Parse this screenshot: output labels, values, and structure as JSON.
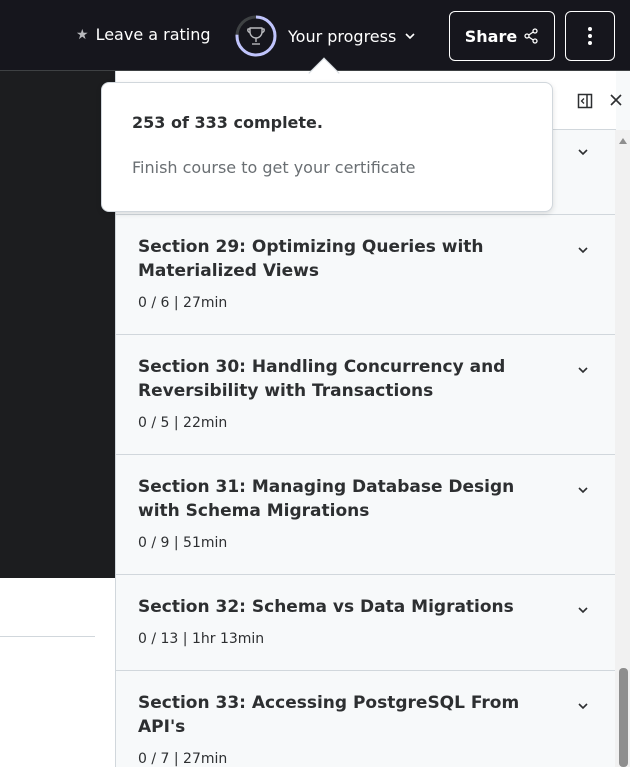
{
  "header": {
    "rating_label": "Leave a rating",
    "progress_label": "Your progress",
    "progress_fraction": 0.76,
    "share_label": "Share",
    "accent_color": "#c0c4fc"
  },
  "popover": {
    "title": "253 of 333 complete.",
    "subtitle": "Finish course to get your certificate"
  },
  "sections": [
    {
      "title": "Section 29: Optimizing Queries with Materialized Views",
      "meta": "0 / 6 | 27min"
    },
    {
      "title": "Section 30: Handling Concurrency and Reversibility with Transactions",
      "meta": "0 / 5 | 22min"
    },
    {
      "title": "Section 31: Managing Database Design with Schema Migrations",
      "meta": "0 / 9 | 51min"
    },
    {
      "title": "Section 32: Schema vs Data Migrations",
      "meta": "0 / 13 | 1hr 13min"
    },
    {
      "title": "Section 33: Accessing PostgreSQL From API's",
      "meta": "0 / 7 | 27min"
    }
  ],
  "icons": {
    "rating": "star-icon",
    "progress": "trophy-icon",
    "share": "share-icon",
    "more": "more-vertical-icon",
    "collapse": "sidebar-collapse-icon",
    "close": "close-icon",
    "expand": "chevron-down-icon"
  }
}
